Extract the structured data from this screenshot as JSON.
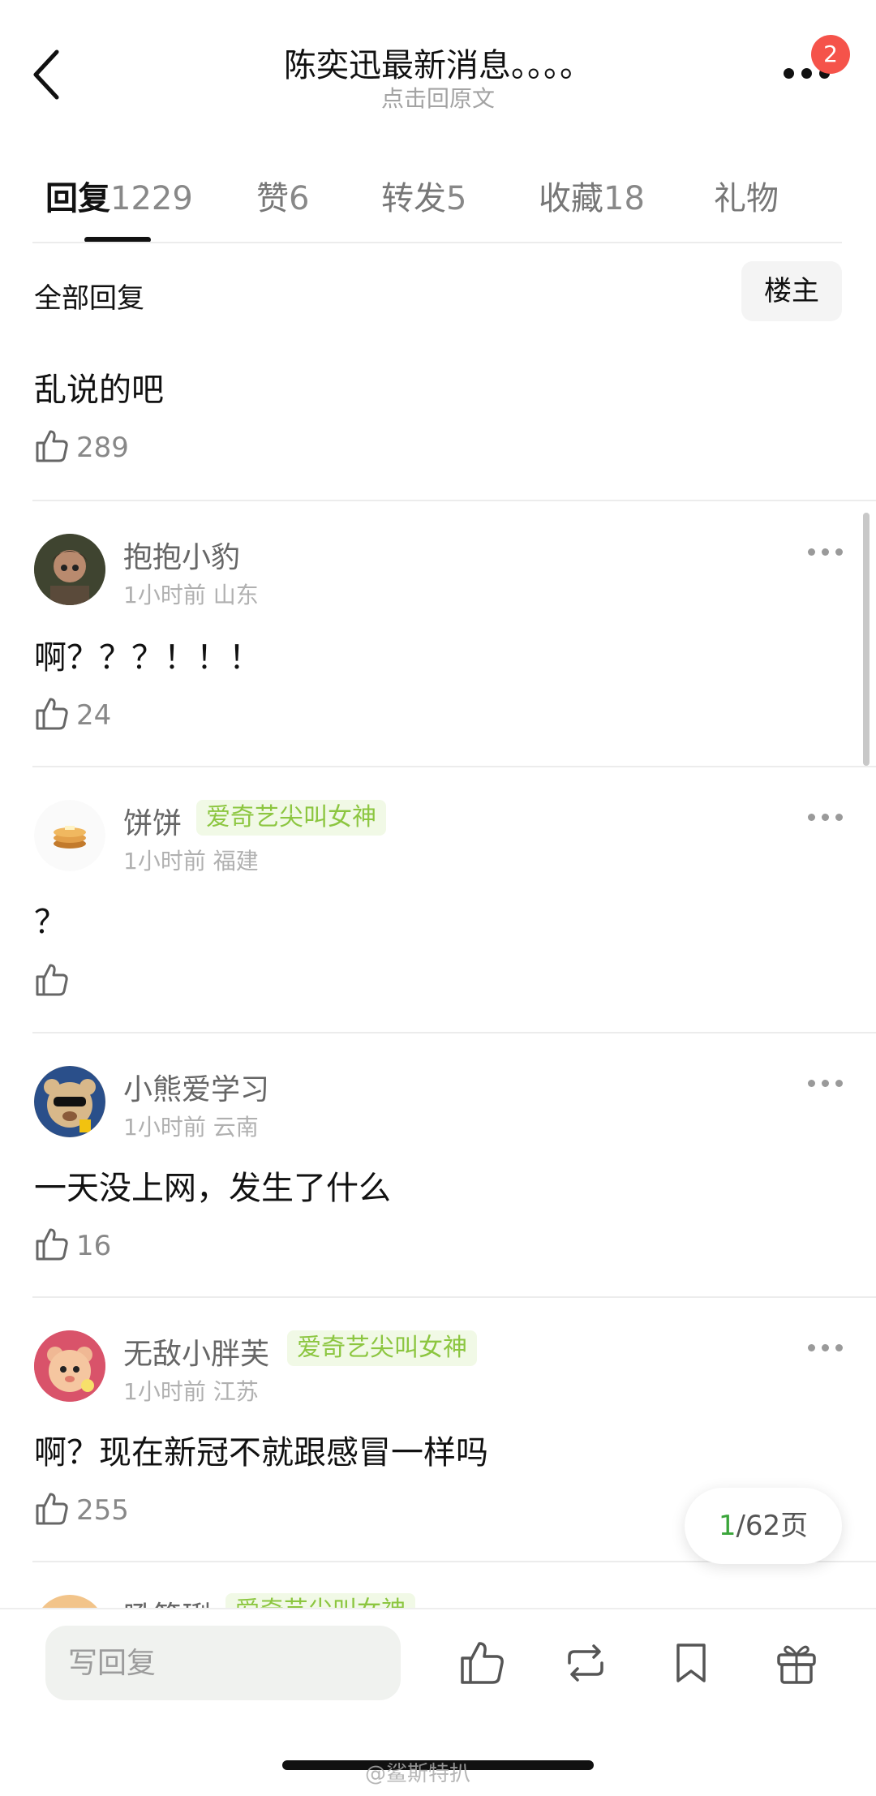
{
  "header": {
    "title": "陈奕迅最新消息。。。。",
    "subtitle": "点击回原文",
    "notification_count": "2"
  },
  "tabs": [
    {
      "label": "回复",
      "count": "1229"
    },
    {
      "label": "赞",
      "count": "6"
    },
    {
      "label": "转发",
      "count": "5"
    },
    {
      "label": "收藏",
      "count": "18"
    },
    {
      "label": "礼物",
      "count": ""
    }
  ],
  "filter": {
    "all_label": "全部回复",
    "op_label": "楼主"
  },
  "first_post": {
    "text": "乱说的吧",
    "likes": "289"
  },
  "comments": [
    {
      "username": "抱抱小豹",
      "tag": "",
      "time": "1小时前",
      "location": "山东",
      "text": "啊？？？！！！",
      "likes": "24",
      "avatar_color": "#4b4f38"
    },
    {
      "username": "饼饼",
      "tag": "爱奇艺尖叫女神",
      "time": "1小时前",
      "location": "福建",
      "text": "？",
      "likes": "",
      "avatar_color": "#e8a94d"
    },
    {
      "username": "小熊爱学习",
      "tag": "",
      "time": "1小时前",
      "location": "云南",
      "text": "一天没上网，发生了什么",
      "likes": "16",
      "avatar_color": "#c9a77a"
    },
    {
      "username": "无敌小胖芙",
      "tag": "爱奇艺尖叫女神",
      "time": "1小时前",
      "location": "江苏",
      "text": "啊？现在新冠不就跟感冒一样吗",
      "likes": "255",
      "avatar_color": "#d9536a"
    }
  ],
  "partial_comment": {
    "username": "吼简琍",
    "tag": "爱奇艺尖叫女神"
  },
  "pagination": {
    "current": "1",
    "total_label": "/62页"
  },
  "bottom_bar": {
    "reply_placeholder": "写回复"
  },
  "watermark": "@鲨斯特扒",
  "colors": {
    "accent_green": "#8cc640",
    "badge_red": "#f5534a",
    "page_green": "#3aa53a"
  }
}
